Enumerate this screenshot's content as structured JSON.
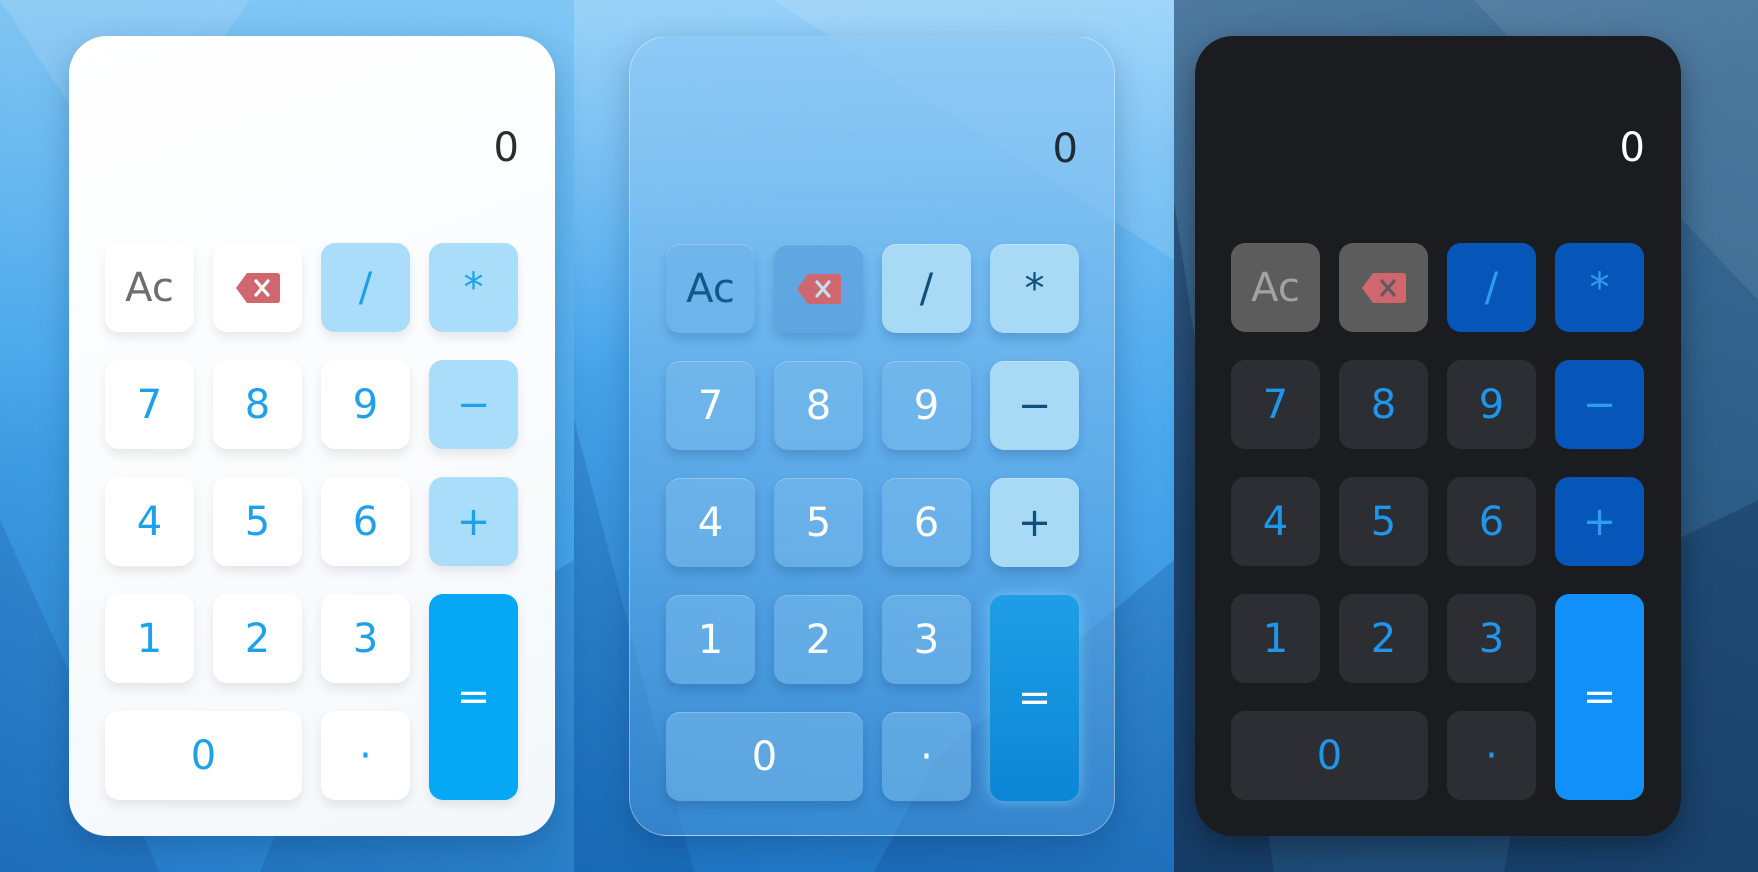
{
  "calculators": [
    {
      "theme": "light",
      "display": "0",
      "keys": {
        "ac": "Ac",
        "del": "backspace-icon",
        "divide": "/",
        "multiply": "*",
        "seven": "7",
        "eight": "8",
        "nine": "9",
        "minus": "−",
        "four": "4",
        "five": "5",
        "six": "6",
        "plus": "+",
        "one": "1",
        "two": "2",
        "three": "3",
        "equals": "=",
        "zero": "0",
        "dot": "·"
      },
      "colors": {
        "key_text": "#1ea0ea",
        "operator_bg": "#a9ddf9",
        "equals_bg": "#06a8f6",
        "backspace": "#d1676e"
      }
    },
    {
      "theme": "glass",
      "display": "0",
      "keys": {
        "ac": "Ac",
        "del": "backspace-icon",
        "divide": "/",
        "multiply": "*",
        "seven": "7",
        "eight": "8",
        "nine": "9",
        "minus": "−",
        "four": "4",
        "five": "5",
        "six": "6",
        "plus": "+",
        "one": "1",
        "two": "2",
        "three": "3",
        "equals": "=",
        "zero": "0",
        "dot": "·"
      },
      "colors": {
        "key_text": "#ffffff",
        "operator_bg": "#a9daf5",
        "equals_bg": "#0b86d6",
        "backspace": "#d1676e"
      }
    },
    {
      "theme": "dark",
      "display": "0",
      "keys": {
        "ac": "Ac",
        "del": "backspace-icon",
        "divide": "/",
        "multiply": "*",
        "seven": "7",
        "eight": "8",
        "nine": "9",
        "minus": "−",
        "four": "4",
        "five": "5",
        "six": "6",
        "plus": "+",
        "one": "1",
        "two": "2",
        "three": "3",
        "equals": "=",
        "zero": "0",
        "dot": "·"
      },
      "colors": {
        "key_text": "#1e96ec",
        "operator_bg": "#0556b8",
        "equals_bg": "#1290fa",
        "backspace": "#d1676e"
      }
    }
  ]
}
